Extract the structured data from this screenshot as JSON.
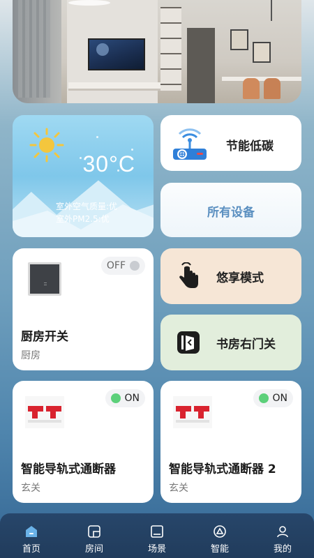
{
  "weather": {
    "temperature": "30°C",
    "air_quality": "室外空气质量:优",
    "pm25": "室外PM2.5:优"
  },
  "tiles": {
    "energy": "节能低碳",
    "all_devices": "所有设备",
    "enjoy_mode": "悠享模式",
    "study_door": "书房右门关"
  },
  "devices": [
    {
      "name": "厨房开关",
      "room": "厨房",
      "status": "OFF",
      "status_color": "#c9ccd1"
    },
    {
      "name": "智能导轨式通断器",
      "room": "玄关",
      "status": "ON",
      "status_color": "#5cd07a"
    },
    {
      "name": "智能导轨式通断器 2",
      "room": "玄关",
      "status": "ON",
      "status_color": "#5cd07a"
    }
  ],
  "nav": [
    {
      "label": "首页",
      "icon": "home-icon",
      "active": true
    },
    {
      "label": "房间",
      "icon": "room-icon"
    },
    {
      "label": "场景",
      "icon": "scene-icon"
    },
    {
      "label": "智能",
      "icon": "smart-icon"
    },
    {
      "label": "我的",
      "icon": "profile-icon"
    }
  ],
  "colors": {
    "active_nav": "#6ab2e8",
    "breaker_red": "#d9232f"
  }
}
